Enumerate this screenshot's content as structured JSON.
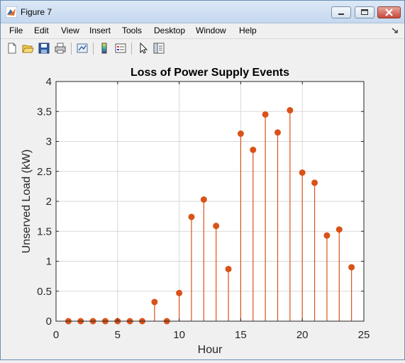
{
  "window": {
    "title": "Figure 7"
  },
  "menu": [
    "File",
    "Edit",
    "View",
    "Insert",
    "Tools",
    "Desktop",
    "Window",
    "Help"
  ],
  "toolbar_icons": [
    "new-figure-icon",
    "open-file-icon",
    "save-icon",
    "print-icon",
    "link-plot-icon",
    "insert-colorbar-icon",
    "insert-legend-icon",
    "edit-plot-icon",
    "property-inspector-icon"
  ],
  "colors": {
    "stem": "#d95319",
    "grid": "#d9d9d9",
    "axes_bg": "#ffffff",
    "axes_line": "#262626"
  },
  "chart_data": {
    "type": "stem",
    "title": "Loss of Power Supply Events",
    "xlabel": "Hour",
    "ylabel": "Unserved Load (kW)",
    "xlim": [
      0,
      25
    ],
    "ylim": [
      0,
      4
    ],
    "xticks": [
      0,
      5,
      10,
      15,
      20,
      25
    ],
    "yticks": [
      0,
      0.5,
      1,
      1.5,
      2,
      2.5,
      3,
      3.5,
      4
    ],
    "ytick_labels": [
      "0",
      "0.5",
      "1",
      "1.5",
      "2",
      "2.5",
      "3",
      "3.5",
      "4"
    ],
    "grid": true,
    "x": [
      1,
      2,
      3,
      4,
      5,
      6,
      7,
      8,
      9,
      10,
      11,
      12,
      13,
      14,
      15,
      16,
      17,
      18,
      19,
      20,
      21,
      22,
      23,
      24
    ],
    "y": [
      0,
      0,
      0,
      0,
      0,
      0,
      0,
      0.32,
      0,
      0.47,
      1.74,
      2.03,
      1.59,
      0.87,
      3.13,
      2.86,
      3.45,
      3.15,
      3.52,
      2.48,
      2.31,
      1.43,
      1.53,
      0.9
    ]
  }
}
